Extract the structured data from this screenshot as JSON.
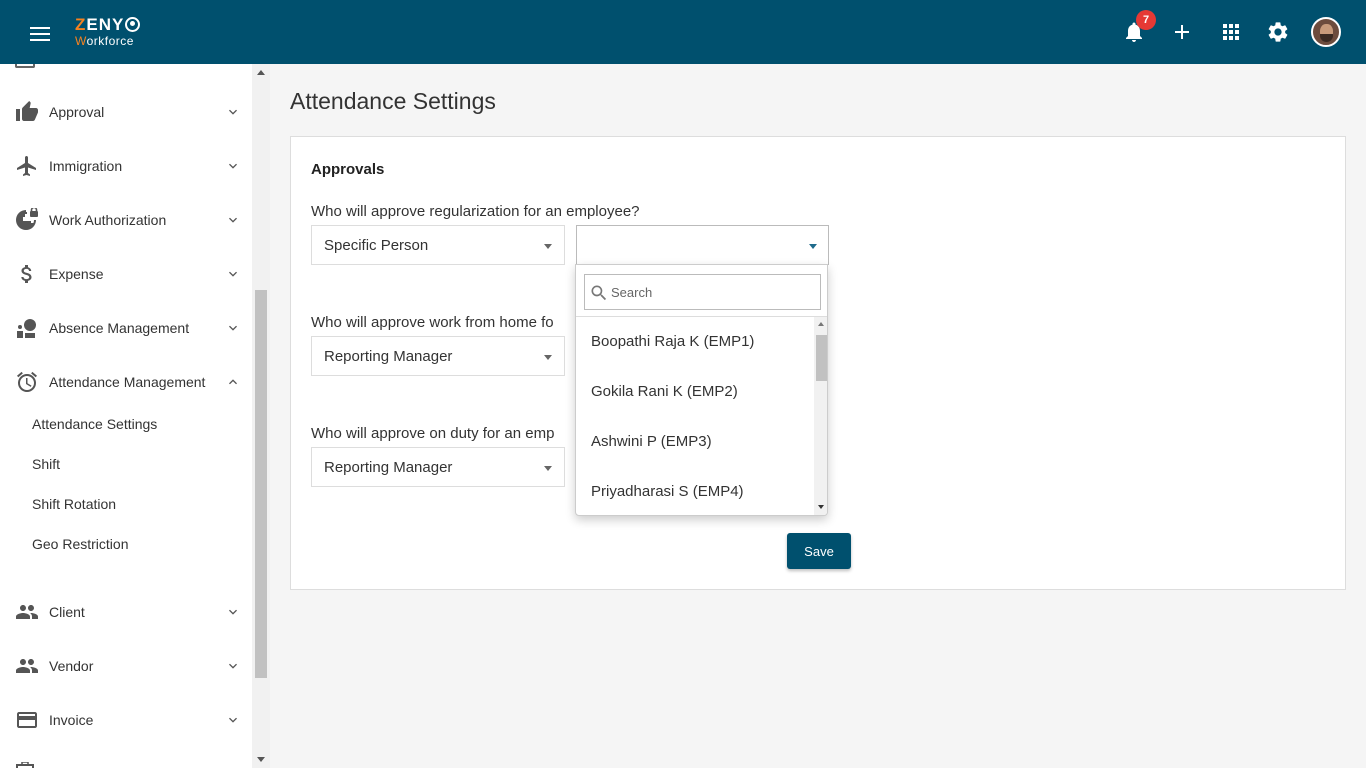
{
  "topbar": {
    "brand": "ZENY",
    "brand_sub": "Workforce",
    "notification_count": "7",
    "icons": [
      "menu-icon",
      "bell-icon",
      "plus-icon",
      "apps-grid-icon",
      "gear-icon"
    ],
    "background_color": "#00506e"
  },
  "sidebar": {
    "items": [
      {
        "label": "Approval",
        "icon": "thumbs-up-icon"
      },
      {
        "label": "Immigration",
        "icon": "airplane-icon"
      },
      {
        "label": "Work Authorization",
        "icon": "globe-lock-icon"
      },
      {
        "label": "Expense",
        "icon": "dollar-icon"
      },
      {
        "label": "Absence Management",
        "icon": "person-away-icon"
      },
      {
        "label": "Attendance Management",
        "icon": "alarm-clock-icon"
      },
      {
        "label": "Client",
        "icon": "people-icon"
      },
      {
        "label": "Vendor",
        "icon": "people-icon"
      },
      {
        "label": "Invoice",
        "icon": "credit-card-icon"
      }
    ],
    "attendance_sub_items": [
      "Attendance Settings",
      "Shift",
      "Shift Rotation",
      "Geo Restriction"
    ]
  },
  "page": {
    "title": "Attendance Settings",
    "section_title": "Approvals",
    "questions": [
      {
        "label": "Who will approve regularization for an employee?",
        "selected": "Specific Person"
      },
      {
        "label": "Who will approve work from home fo",
        "selected": "Reporting Manager"
      },
      {
        "label": "Who will approve on duty for an emp",
        "selected": "Reporting Manager"
      }
    ],
    "save_label": "Save"
  },
  "dropdown": {
    "search_placeholder": "Search",
    "search_value": "",
    "options": [
      "Boopathi Raja K (EMP1)",
      "Gokila Rani K (EMP2)",
      "Ashwini P (EMP3)",
      "Priyadharasi S (EMP4)"
    ]
  }
}
